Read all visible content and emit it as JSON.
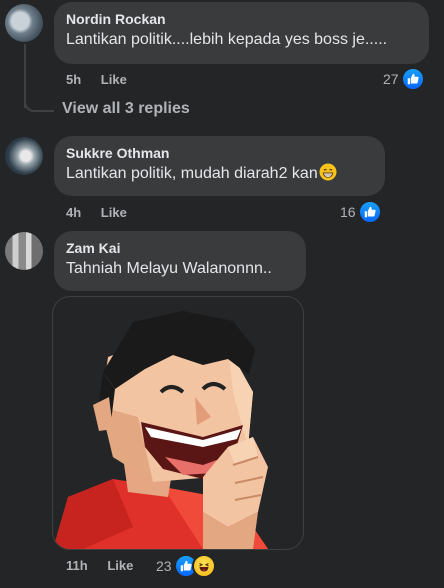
{
  "comments": [
    {
      "author": "Nordin Rockan",
      "text": "Lantikan politik....lebih kepada yes boss je.....",
      "time": "5h",
      "like_label": "Like",
      "reaction_count": "27",
      "replies_link": "View all 3 replies"
    },
    {
      "author": "Sukkre Othman",
      "text": "Lantikan politik, mudah diarah2 kan",
      "emoji": "grinning-face",
      "time": "4h",
      "like_label": "Like",
      "reaction_count": "16"
    },
    {
      "author": "Zam Kai",
      "text": "Tahniah Melayu Walanonnn..",
      "sticker": "laughing-man-sticker",
      "time": "11h",
      "like_label": "Like",
      "reaction_count": "23",
      "reactions": [
        "like",
        "haha"
      ]
    }
  ],
  "colors": {
    "background": "#242526",
    "bubble": "#3a3b3c",
    "primary_text": "#e4e6eb",
    "secondary_text": "#b0b3b8",
    "like_blue": "#0866ff"
  }
}
